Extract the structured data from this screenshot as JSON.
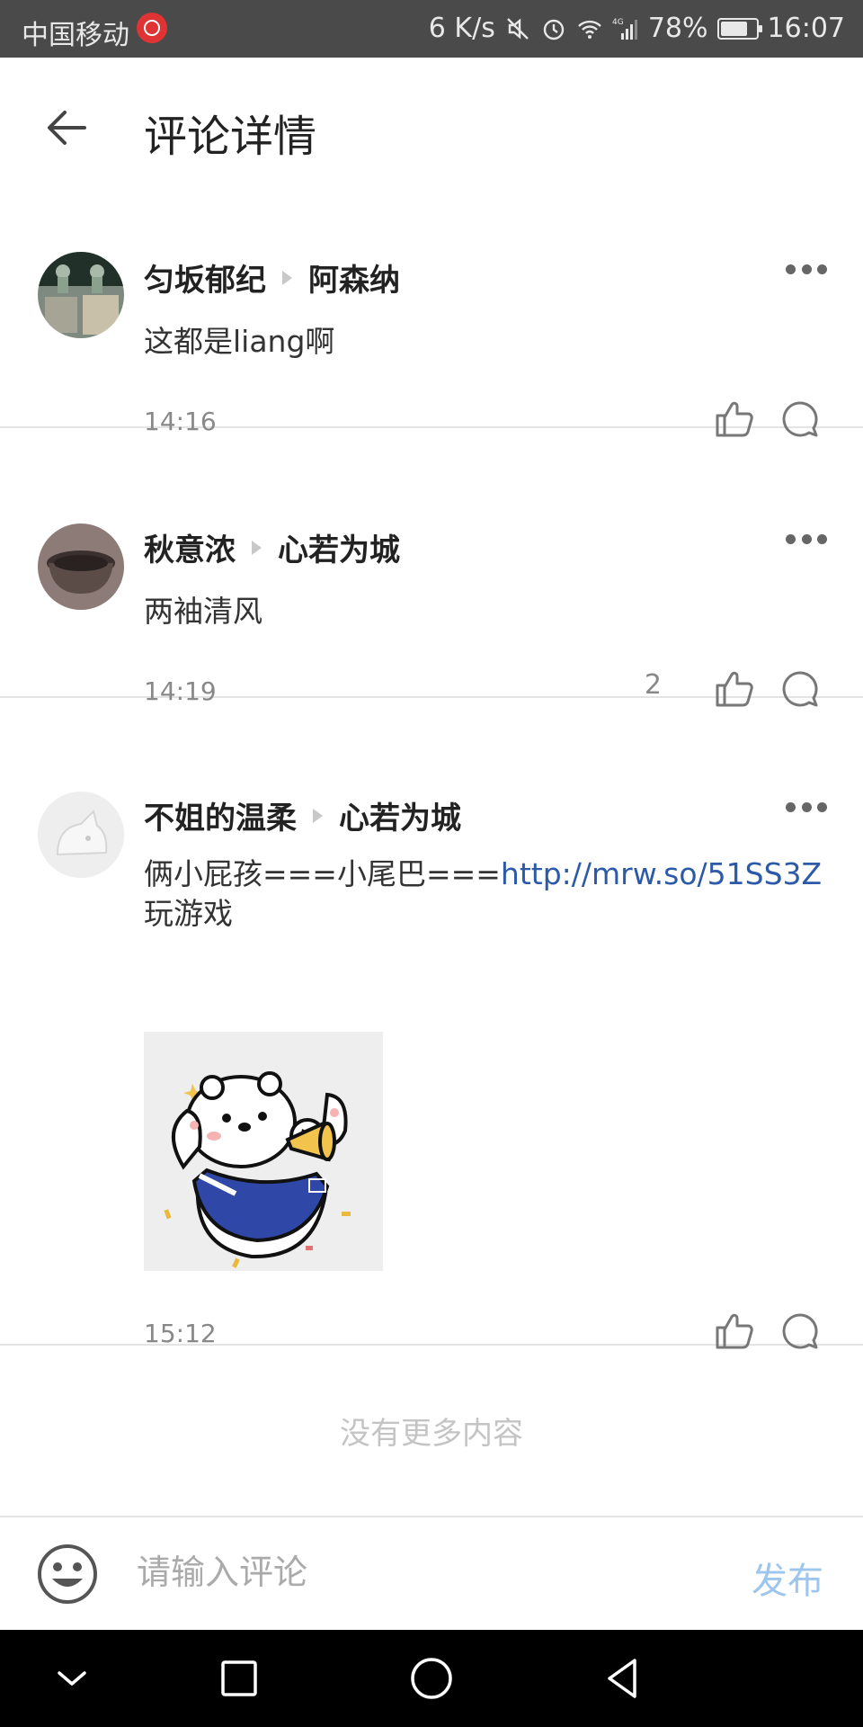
{
  "status_bar": {
    "carrier": "中国移动",
    "net_speed": "6 K/s",
    "network": "4G",
    "battery": "78%",
    "battery_level": 0.78,
    "time": "16:07"
  },
  "header": {
    "title": "评论详情"
  },
  "comments": [
    {
      "author": "匀坂郁纪",
      "reply_to": "阿森纳",
      "text": "这都是liang啊",
      "time": "14:16",
      "likes": ""
    },
    {
      "author": "秋意浓",
      "reply_to": "心若为城",
      "text": "两袖清风",
      "time": "14:19",
      "likes": "2"
    },
    {
      "author": "不姐的温柔",
      "reply_to": "心若为城",
      "text_prefix": "俩小屁孩===小尾巴===",
      "link": "http://mrw.so/51SS3Z",
      "text_suffix": "玩游戏",
      "time": "15:12",
      "likes": ""
    }
  ],
  "footer": {
    "no_more": "没有更多内容"
  },
  "composer": {
    "placeholder": "请输入评论",
    "publish_label": "发布"
  },
  "colors": {
    "link": "#2c5aa8",
    "publish_disabled": "#9cc6ee",
    "jersey_blue": "#2f48a8"
  }
}
